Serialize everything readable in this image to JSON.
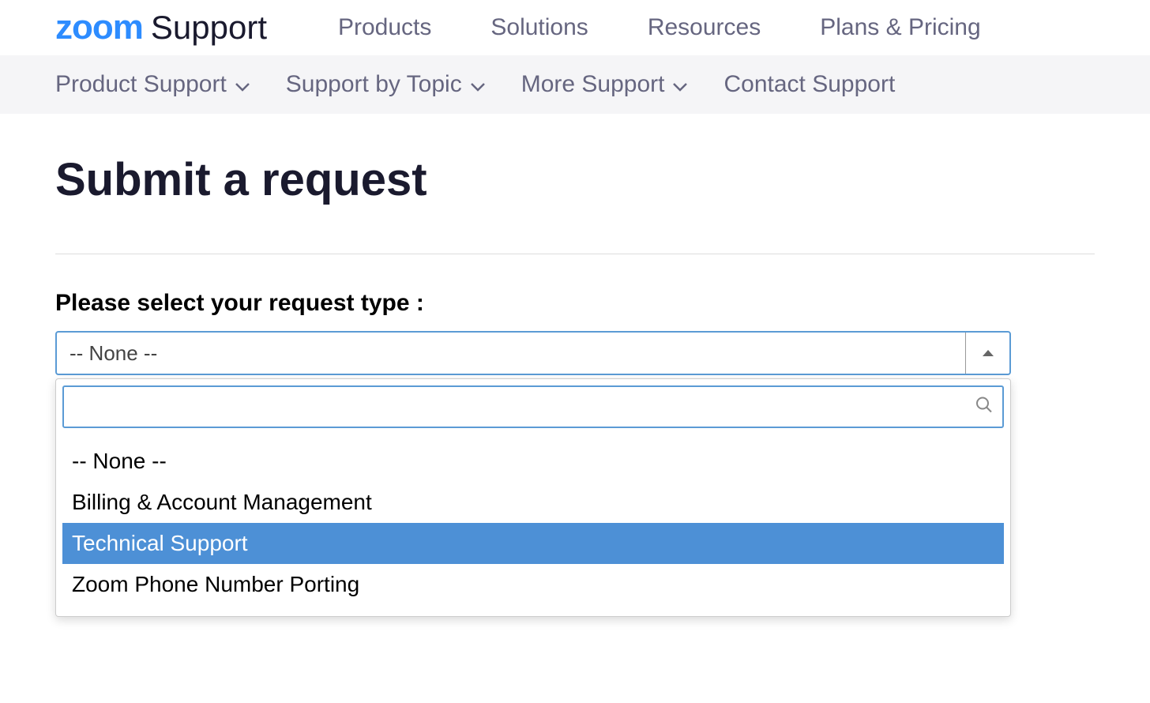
{
  "logo": {
    "brand": "zoom",
    "suffix": "Support"
  },
  "topNav": {
    "items": [
      "Products",
      "Solutions",
      "Resources",
      "Plans & Pricing"
    ]
  },
  "subNav": {
    "items": [
      {
        "label": "Product Support",
        "hasDropdown": true
      },
      {
        "label": "Support by Topic",
        "hasDropdown": true
      },
      {
        "label": "More Support",
        "hasDropdown": true
      },
      {
        "label": "Contact Support",
        "hasDropdown": false
      }
    ]
  },
  "page": {
    "title": "Submit a request"
  },
  "form": {
    "requestType": {
      "label": "Please select your request type :",
      "selectedValue": "-- None --",
      "searchValue": "",
      "options": [
        {
          "label": "-- None --",
          "highlighted": false
        },
        {
          "label": "Billing & Account Management",
          "highlighted": false
        },
        {
          "label": "Technical Support",
          "highlighted": true
        },
        {
          "label": "Zoom Phone Number Porting",
          "highlighted": false
        }
      ]
    }
  },
  "colors": {
    "brandBlue": "#2D8CFF",
    "navText": "#666680",
    "highlight": "#4d90d6",
    "focusBorder": "#5b9bd5"
  }
}
